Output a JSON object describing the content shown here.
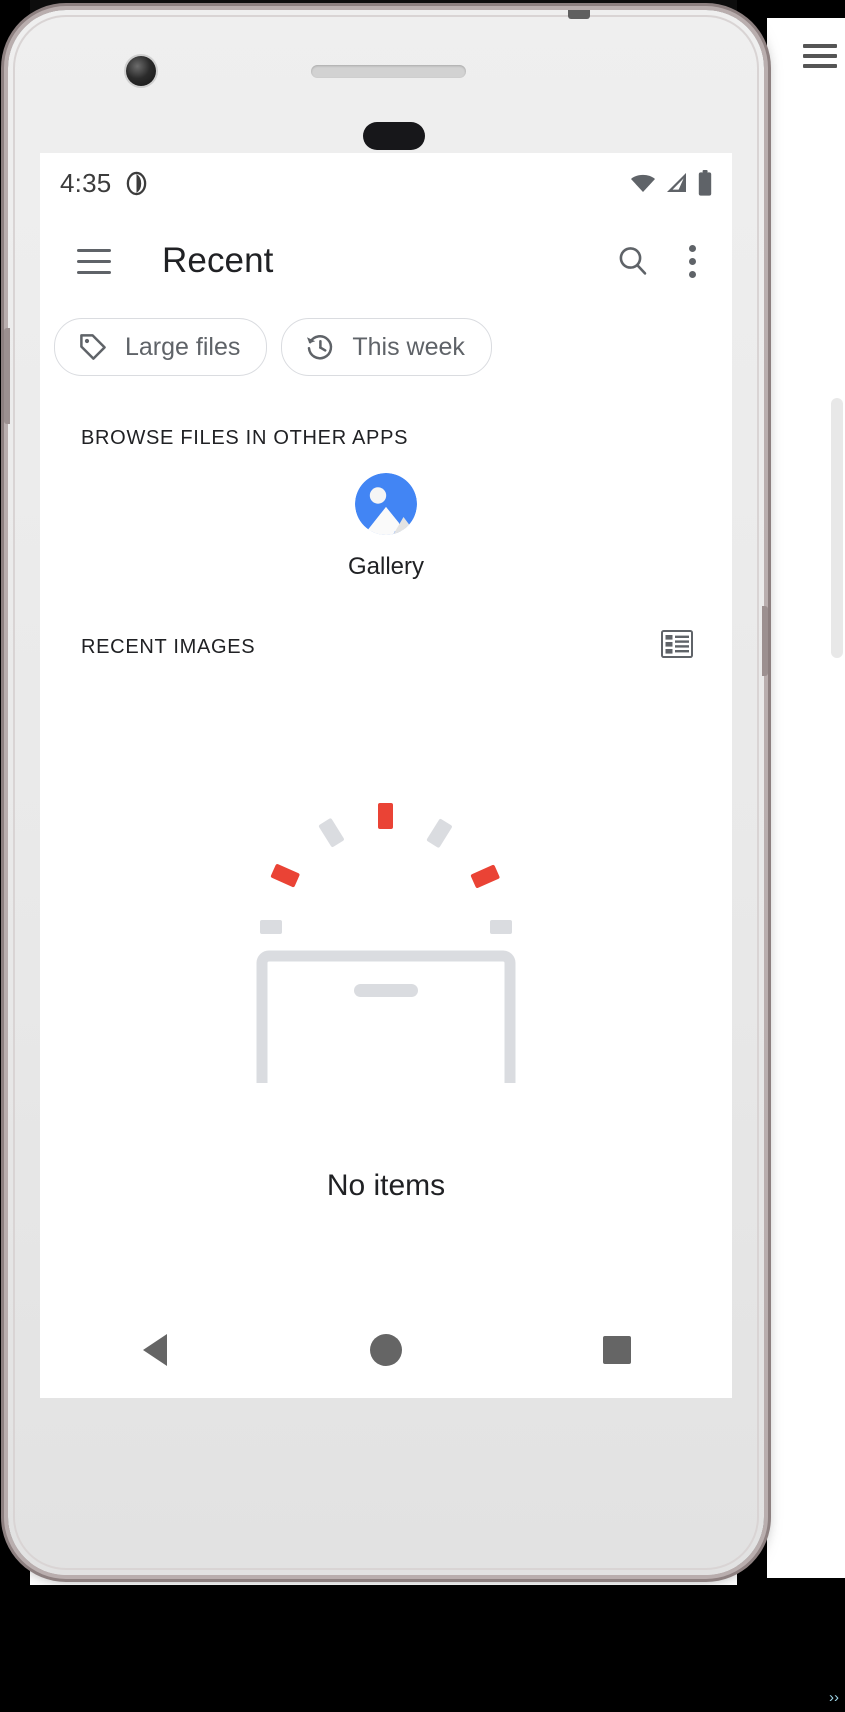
{
  "statusbar": {
    "time": "4:35",
    "alarm_icon": "alarm-clock-icon",
    "wifi_icon": "wifi-icon",
    "signal_icon": "cell-signal-icon",
    "battery_icon": "battery-full-icon"
  },
  "toolbar": {
    "menu_icon": "hamburger-menu-icon",
    "title": "Recent",
    "search_icon": "search-icon",
    "more_icon": "overflow-menu-icon"
  },
  "chips": [
    {
      "label": "Large files",
      "icon": "tag-icon"
    },
    {
      "label": "This week",
      "icon": "history-clock-icon"
    }
  ],
  "sections": {
    "browse_apps_header": "BROWSE FILES IN OTHER APPS",
    "recent_images_header": "RECENT IMAGES",
    "view_toggle_icon": "list-view-icon"
  },
  "apps": [
    {
      "label": "Gallery",
      "icon": "gallery-app-icon"
    }
  ],
  "empty_state": {
    "illustration": "empty-box-confetti-illustration",
    "message": "No items"
  },
  "navbar": {
    "back": "back-nav-button",
    "home": "home-nav-button",
    "recents": "recents-nav-button"
  },
  "colors": {
    "accent_blue": "#4285f4",
    "confetti_red": "#ea4335",
    "confetti_gray": "#dadce0",
    "text_primary": "#202124",
    "text_secondary": "#5f6368",
    "border": "#dadce0"
  }
}
